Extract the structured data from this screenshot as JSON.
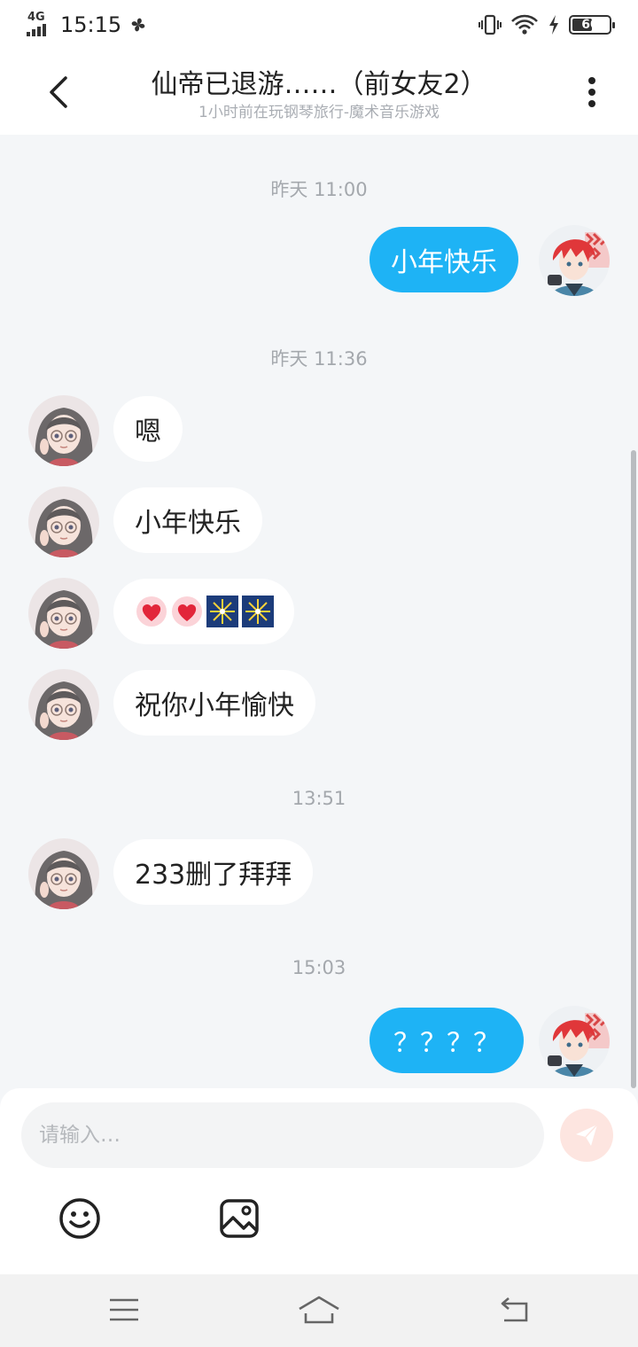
{
  "status_bar": {
    "network": "4G",
    "time": "15:15",
    "battery": "60",
    "battery_level": 0.6
  },
  "header": {
    "title": "仙帝已退游……（前女友2）",
    "subtitle": "1小时前在玩钢琴旅行-魔术音乐游戏"
  },
  "messages": {
    "ts1": "昨天 11:00",
    "m1": "小年快乐",
    "ts2": "昨天 11:36",
    "m2": "嗯",
    "m3": "小年快乐",
    "m4": "💗💗🎆🎆",
    "m5": "祝你小年愉快",
    "ts3": "13:51",
    "m6": "233删了拜拜",
    "ts4": "15:03",
    "m7": "？？？？"
  },
  "input": {
    "placeholder": "请输入…"
  },
  "colors": {
    "outgoing_bubble": "#1eb3f5",
    "incoming_bubble": "#ffffff",
    "background": "#f4f6f8",
    "send_button": "#fde5e0"
  },
  "icons": {
    "back": "back-arrow-icon",
    "more": "more-vertical-icon",
    "emoji": "emoji-smile-icon",
    "image": "image-icon",
    "send": "send-paper-plane-icon",
    "menu": "menu-icon",
    "home": "home-icon",
    "return": "back-return-icon"
  }
}
